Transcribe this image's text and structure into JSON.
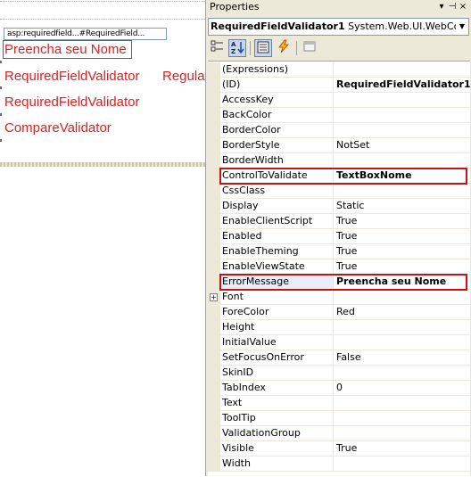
{
  "designer": {
    "smart_tag": "asp:requiredfield...#RequiredField...",
    "textbox_text": "Preencha seu Nome",
    "row1_validator": "RequiredFieldValidator",
    "row1_validator_cut": "Regula",
    "row2_validator": "RequiredFieldValidator",
    "row3_validator": "CompareValidator"
  },
  "panel": {
    "title": "Properties",
    "btn_pin": "▾",
    "btn_dock": "⊣",
    "btn_close": "×",
    "object_name": "RequiredFieldValidator1",
    "object_type": "System.Web.UI.WebContro"
  },
  "properties": [
    {
      "name": "(Expressions)",
      "value": ""
    },
    {
      "name": "(ID)",
      "value": "RequiredFieldValidator1"
    },
    {
      "name": "AccessKey",
      "value": ""
    },
    {
      "name": "BackColor",
      "value": ""
    },
    {
      "name": "BorderColor",
      "value": ""
    },
    {
      "name": "BorderStyle",
      "value": "NotSet"
    },
    {
      "name": "BorderWidth",
      "value": ""
    },
    {
      "name": "ControlToValidate",
      "value": "TextBoxNome"
    },
    {
      "name": "CssClass",
      "value": ""
    },
    {
      "name": "Display",
      "value": "Static"
    },
    {
      "name": "EnableClientScript",
      "value": "True"
    },
    {
      "name": "Enabled",
      "value": "True"
    },
    {
      "name": "EnableTheming",
      "value": "True"
    },
    {
      "name": "EnableViewState",
      "value": "True"
    },
    {
      "name": "ErrorMessage",
      "value": "Preencha seu Nome"
    },
    {
      "name": "Font",
      "value": "",
      "expand": "+"
    },
    {
      "name": "ForeColor",
      "value": "Red"
    },
    {
      "name": "Height",
      "value": ""
    },
    {
      "name": "InitialValue",
      "value": ""
    },
    {
      "name": "SetFocusOnError",
      "value": "False"
    },
    {
      "name": "SkinID",
      "value": ""
    },
    {
      "name": "TabIndex",
      "value": "0"
    },
    {
      "name": "Text",
      "value": ""
    },
    {
      "name": "ToolTip",
      "value": ""
    },
    {
      "name": "ValidationGroup",
      "value": ""
    },
    {
      "name": "Visible",
      "value": "True"
    },
    {
      "name": "Width",
      "value": ""
    }
  ],
  "colors": {
    "validator_text": "#e02020",
    "highlight_border": "#cc1010",
    "panel_bg": "#ece9d8"
  }
}
